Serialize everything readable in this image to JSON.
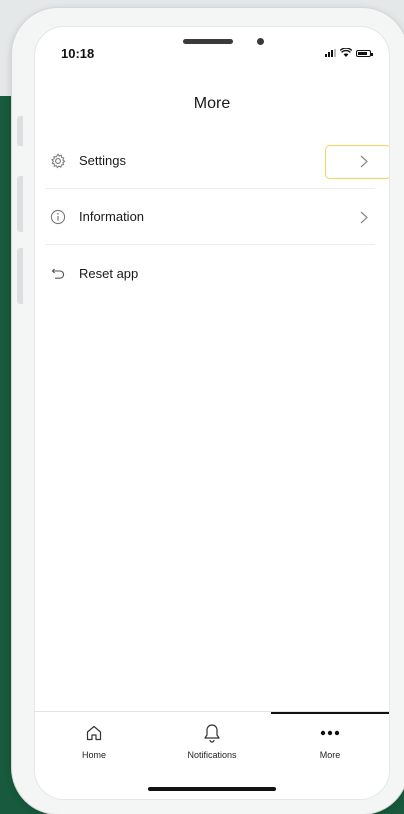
{
  "status_bar": {
    "time": "10:18"
  },
  "header": {
    "title": "More"
  },
  "menu": {
    "items": [
      {
        "label": "Settings",
        "icon": "gear-icon",
        "has_chevron": true
      },
      {
        "label": "Information",
        "icon": "info-icon",
        "has_chevron": true
      },
      {
        "label": "Reset app",
        "icon": "reset-icon",
        "has_chevron": false
      }
    ]
  },
  "tab_bar": {
    "tabs": [
      {
        "label": "Home",
        "icon": "home-icon"
      },
      {
        "label": "Notifications",
        "icon": "bell-icon"
      },
      {
        "label": "More",
        "icon": "more-dots-icon",
        "active": true
      }
    ]
  },
  "colors": {
    "backdrop": "#175a3d",
    "highlight": "#f2d45c",
    "text": "#1a1a1a"
  }
}
